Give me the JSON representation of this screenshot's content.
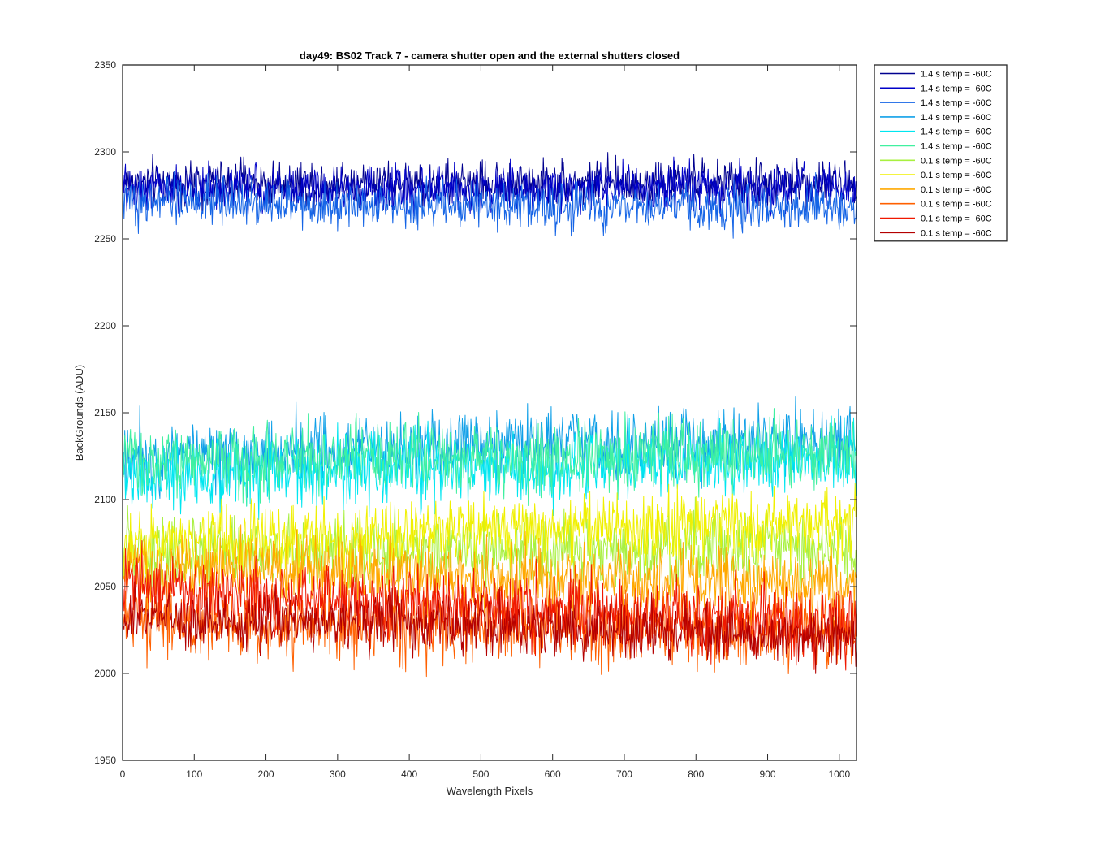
{
  "chart_data": {
    "type": "line",
    "title": "day49: BS02  Track 7 - camera shutter open and the external shutters closed",
    "xlabel": "Wavelength Pixels",
    "ylabel": "BackGrounds (ADU)",
    "xlim": [
      0,
      1024
    ],
    "ylim": [
      1950,
      2350
    ],
    "xticks": [
      "0",
      "100",
      "200",
      "300",
      "400",
      "500",
      "600",
      "700",
      "800",
      "900",
      "1000"
    ],
    "yticks": [
      "1950",
      "2000",
      "2050",
      "2100",
      "2150",
      "2200",
      "2250",
      "2300",
      "2350"
    ],
    "grid": false,
    "legend_position": "outside-top-right",
    "series": [
      {
        "name": "1.4 s temp = -60C",
        "color": "#00008F",
        "mean": 2282,
        "noise": 6.5,
        "drift": 0,
        "x_range": [
          1,
          1024
        ]
      },
      {
        "name": "1.4 s temp = -60C",
        "color": "#0000C8",
        "mean": 2279,
        "noise": 6.5,
        "drift": 0,
        "x_range": [
          1,
          1024
        ]
      },
      {
        "name": "1.4 s temp = -60C",
        "color": "#1464E6",
        "mean": 2272,
        "noise": 6.5,
        "drift": -5,
        "x_range": [
          1,
          1024
        ]
      },
      {
        "name": "1.4 s temp = -60C",
        "color": "#10A0E8",
        "mean": 2126,
        "noise": 10,
        "drift": 8,
        "x_range": [
          1,
          1024
        ]
      },
      {
        "name": "1.4 s temp = -60C",
        "color": "#00E6F0",
        "mean": 2113,
        "noise": 10,
        "drift": 10,
        "x_range": [
          1,
          1024
        ]
      },
      {
        "name": "1.4 s temp = -60C",
        "color": "#40F0A0",
        "mean": 2122,
        "noise": 10,
        "drift": 5,
        "x_range": [
          1,
          1024
        ]
      },
      {
        "name": "0.1 s temp = -60C",
        "color": "#A8F040",
        "mean": 2070,
        "noise": 10,
        "drift": 0,
        "x_range": [
          1,
          1024
        ]
      },
      {
        "name": "0.1 s temp = -60C",
        "color": "#F0F000",
        "mean": 2075,
        "noise": 10,
        "drift": 12,
        "x_range": [
          1,
          1024
        ]
      },
      {
        "name": "0.1 s temp = -60C",
        "color": "#FFA800",
        "mean": 2062,
        "noise": 10,
        "drift": -12,
        "x_range": [
          1,
          1024
        ]
      },
      {
        "name": "0.1 s temp = -60C",
        "color": "#FF6000",
        "mean": 2030,
        "noise": 11,
        "drift": -5,
        "x_range": [
          1,
          1024
        ]
      },
      {
        "name": "0.1 s temp = -60C",
        "color": "#F01800",
        "mean": 2050,
        "noise": 10,
        "drift": -22,
        "x_range": [
          1,
          1024
        ]
      },
      {
        "name": "0.1 s temp = -60C",
        "color": "#B40000",
        "mean": 2033,
        "noise": 8,
        "drift": -12,
        "x_range": [
          1,
          1024
        ]
      }
    ]
  }
}
